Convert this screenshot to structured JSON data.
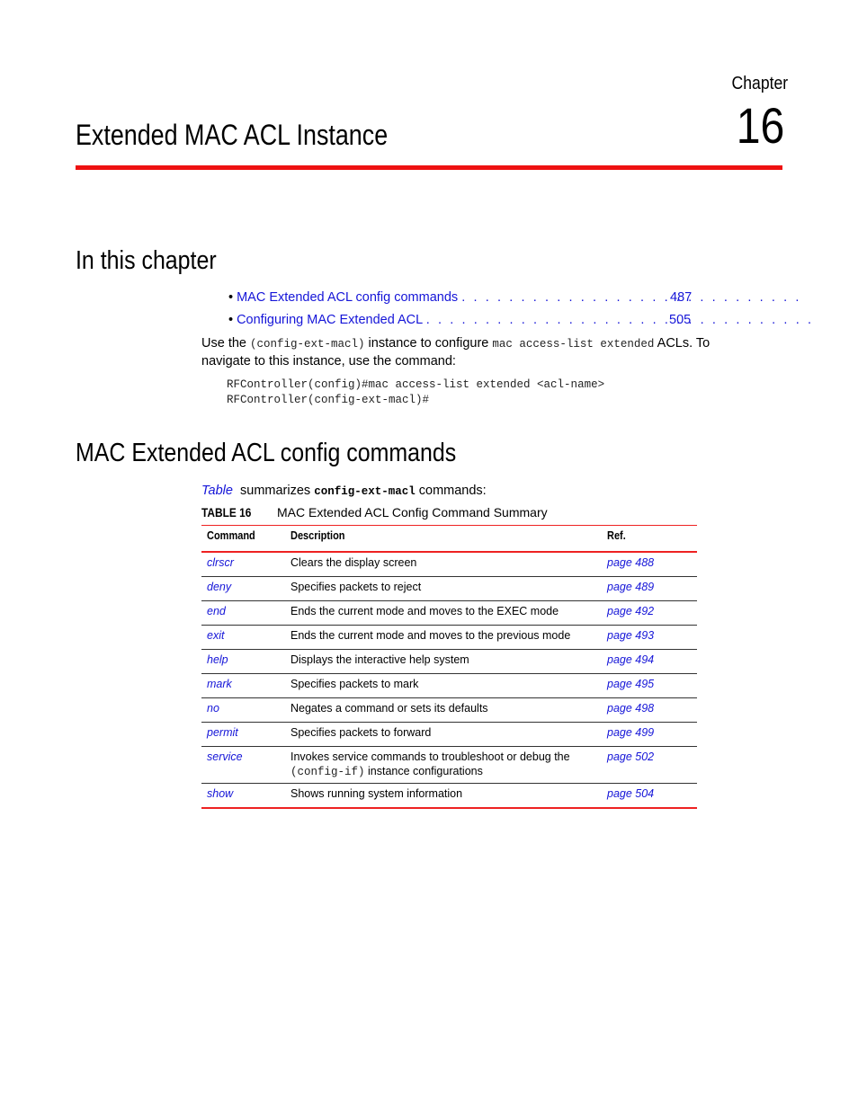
{
  "header": {
    "chapter_label": "Chapter",
    "chapter_number": "16",
    "title": "Extended MAC ACL Instance",
    "accent_color": "#ee1111"
  },
  "in_this_chapter": {
    "heading": "In this chapter",
    "toc": [
      {
        "label": "MAC Extended ACL config commands",
        "dots": ". . . . . . . . . . . . . . . . . . . . . . . . . . . . .",
        "page": "487"
      },
      {
        "label": "Configuring MAC Extended ACL",
        "dots": ". . . . . . . . . . . . . . . . . . . . . . . . . . . . . . . . .",
        "page": "505"
      }
    ],
    "intro": {
      "t1": "Use the ",
      "code1": "(config-ext-macl)",
      "t2": " instance to configure ",
      "code2": "mac access-list extended",
      "t3": " ACLs. To navigate to this instance, use the command:"
    },
    "code_lines": [
      "RFController(config)#mac access-list extended <acl-name>",
      "RFController(config-ext-macl)#"
    ]
  },
  "section": {
    "heading": "MAC Extended ACL config commands",
    "summary": {
      "link": "Table",
      "t1": "  summarizes ",
      "code": "config-ext-macl",
      "t2": " commands:"
    },
    "table_caption": {
      "label": "TABLE 16",
      "text": "MAC Extended ACL Config Command Summary"
    },
    "table": {
      "headers": [
        "Command",
        "Description",
        "Ref."
      ],
      "rows": [
        {
          "command": "clrscr",
          "description": "Clears the display screen",
          "ref": "page 488"
        },
        {
          "command": "deny",
          "description": "Specifies packets to reject",
          "ref": "page 489"
        },
        {
          "command": "end",
          "description": "Ends the current mode and moves to the EXEC mode",
          "ref": "page 492"
        },
        {
          "command": "exit",
          "description": "Ends the current mode and moves to the previous mode",
          "ref": "page 493"
        },
        {
          "command": "help",
          "description": "Displays the interactive help system",
          "ref": "page 494"
        },
        {
          "command": "mark",
          "description": "Specifies packets to mark",
          "ref": "page 495"
        },
        {
          "command": "no",
          "description": "Negates a command or sets its defaults",
          "ref": "page 498"
        },
        {
          "command": "permit",
          "description": "Specifies packets to forward",
          "ref": "page 499"
        },
        {
          "command": "service",
          "description": "Invokes service commands to troubleshoot or debug the",
          "description_code": "(config-if)",
          "description_tail": " instance configurations",
          "ref": "page 502"
        },
        {
          "command": "show",
          "description": "Shows running system information",
          "ref": "page 504"
        }
      ]
    }
  }
}
